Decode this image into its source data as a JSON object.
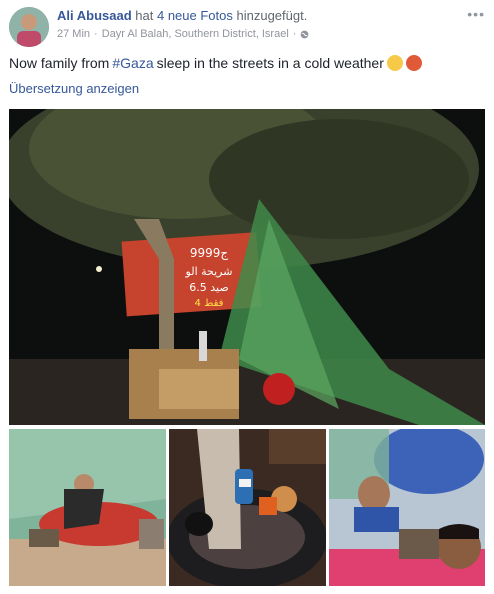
{
  "post": {
    "author": "Ali Abusaad",
    "verb_before": "hat",
    "photos_link": "4 neue Fotos",
    "verb_after": "hinzugefügt.",
    "time": "27 Min",
    "separator": "·",
    "location": "Dayr Al Balah, Southern District, Israel",
    "separator2": "·",
    "more_label": "•••",
    "text_before": "Now family from",
    "hashtag": "#Gaza",
    "text_after": "sleep in the streets in a cold weather",
    "translate_label": "Übersetzung anzeigen"
  },
  "icons": {
    "privacy": "globe-icon",
    "emoji_1": "relieved-face-emoji",
    "emoji_2": "angry-face-emoji",
    "more": "more-options-icon"
  },
  "sign": {
    "line1": "9999ج",
    "line2": "شريحة الو",
    "line3": "صيد 6.5",
    "line4": "فقط 4"
  },
  "colors": {
    "link": "#365899",
    "meta": "#90949c",
    "text": "#1d2129"
  }
}
